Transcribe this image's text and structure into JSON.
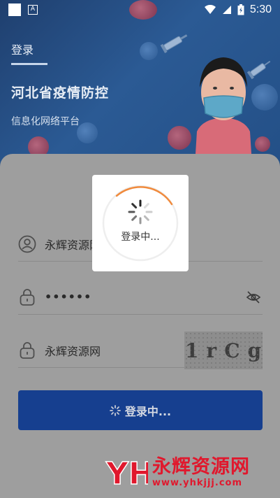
{
  "status_bar": {
    "time": "5:30",
    "left_icons": [
      "notification-square-icon",
      "font-a-icon"
    ],
    "right_icons": [
      "wifi-icon",
      "signal-icon",
      "battery-charging-icon"
    ]
  },
  "header": {
    "page_label": "登录",
    "title": "河北省疫情防控",
    "subtitle": "信息化网络平台"
  },
  "form": {
    "username": {
      "icon": "user-icon",
      "value": "永辉资源网"
    },
    "password": {
      "icon": "lock-icon",
      "value": "••••••",
      "toggle_icon": "eye-hidden-icon"
    },
    "captcha": {
      "icon": "lock-icon",
      "value": "永辉资源网",
      "captcha_text": [
        "1",
        "r",
        "C",
        "g"
      ]
    },
    "submit_label": "登录中..."
  },
  "loading_dialog": {
    "text": "登录中..."
  },
  "watermark": {
    "logo_text": "YH",
    "title": "永辉资源网",
    "url": "www.yhkjjj.com"
  },
  "colors": {
    "hero_bg": "#2b5a94",
    "button": "#163f8f",
    "spinner_accent": "#f08a3c",
    "watermark": "#e0182d"
  }
}
